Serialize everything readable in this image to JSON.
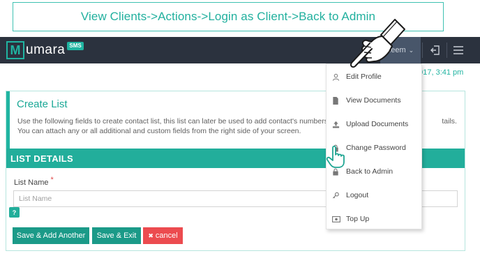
{
  "banner": {
    "text": "View Clients->Actions->Login as Client->Back to Admin"
  },
  "navbar": {
    "logo_letter": "M",
    "logo_text": "umara",
    "logo_badge": "SMS",
    "user_name": "zeem",
    "user_caret": "⌄"
  },
  "date_text": "2017, 3:41 pm",
  "dropdown": {
    "items": [
      {
        "label": "Edit Profile",
        "icon": "user-icon"
      },
      {
        "label": "View Documents",
        "icon": "document-icon"
      },
      {
        "label": "Upload Documents",
        "icon": "upload-icon"
      },
      {
        "label": "Change Password",
        "icon": "lock-icon"
      },
      {
        "label": "Back to Admin",
        "icon": "lock-icon"
      },
      {
        "label": "Logout",
        "icon": "key-icon"
      },
      {
        "label": "Top Up",
        "icon": "money-icon"
      }
    ]
  },
  "panel": {
    "title": "Create List",
    "description": "Use the following fields to create contact list, this list can later be used to add contact's numbers                                                        tails. You can attach any or all additional and custom fields from the right side of your screen.",
    "section_title": "LIST DETAILS",
    "field_label": "List Name",
    "required_mark": "*",
    "field_placeholder": "List Name",
    "help_label": "?",
    "buttons": {
      "save_add": "Save & Add Another",
      "save_exit": "Save & Exit",
      "cancel": "cancel",
      "cancel_icon": "✖"
    }
  },
  "colors": {
    "accent": "#22ae9b",
    "navbar": "#2b323e",
    "cancel": "#ec4b4f"
  }
}
